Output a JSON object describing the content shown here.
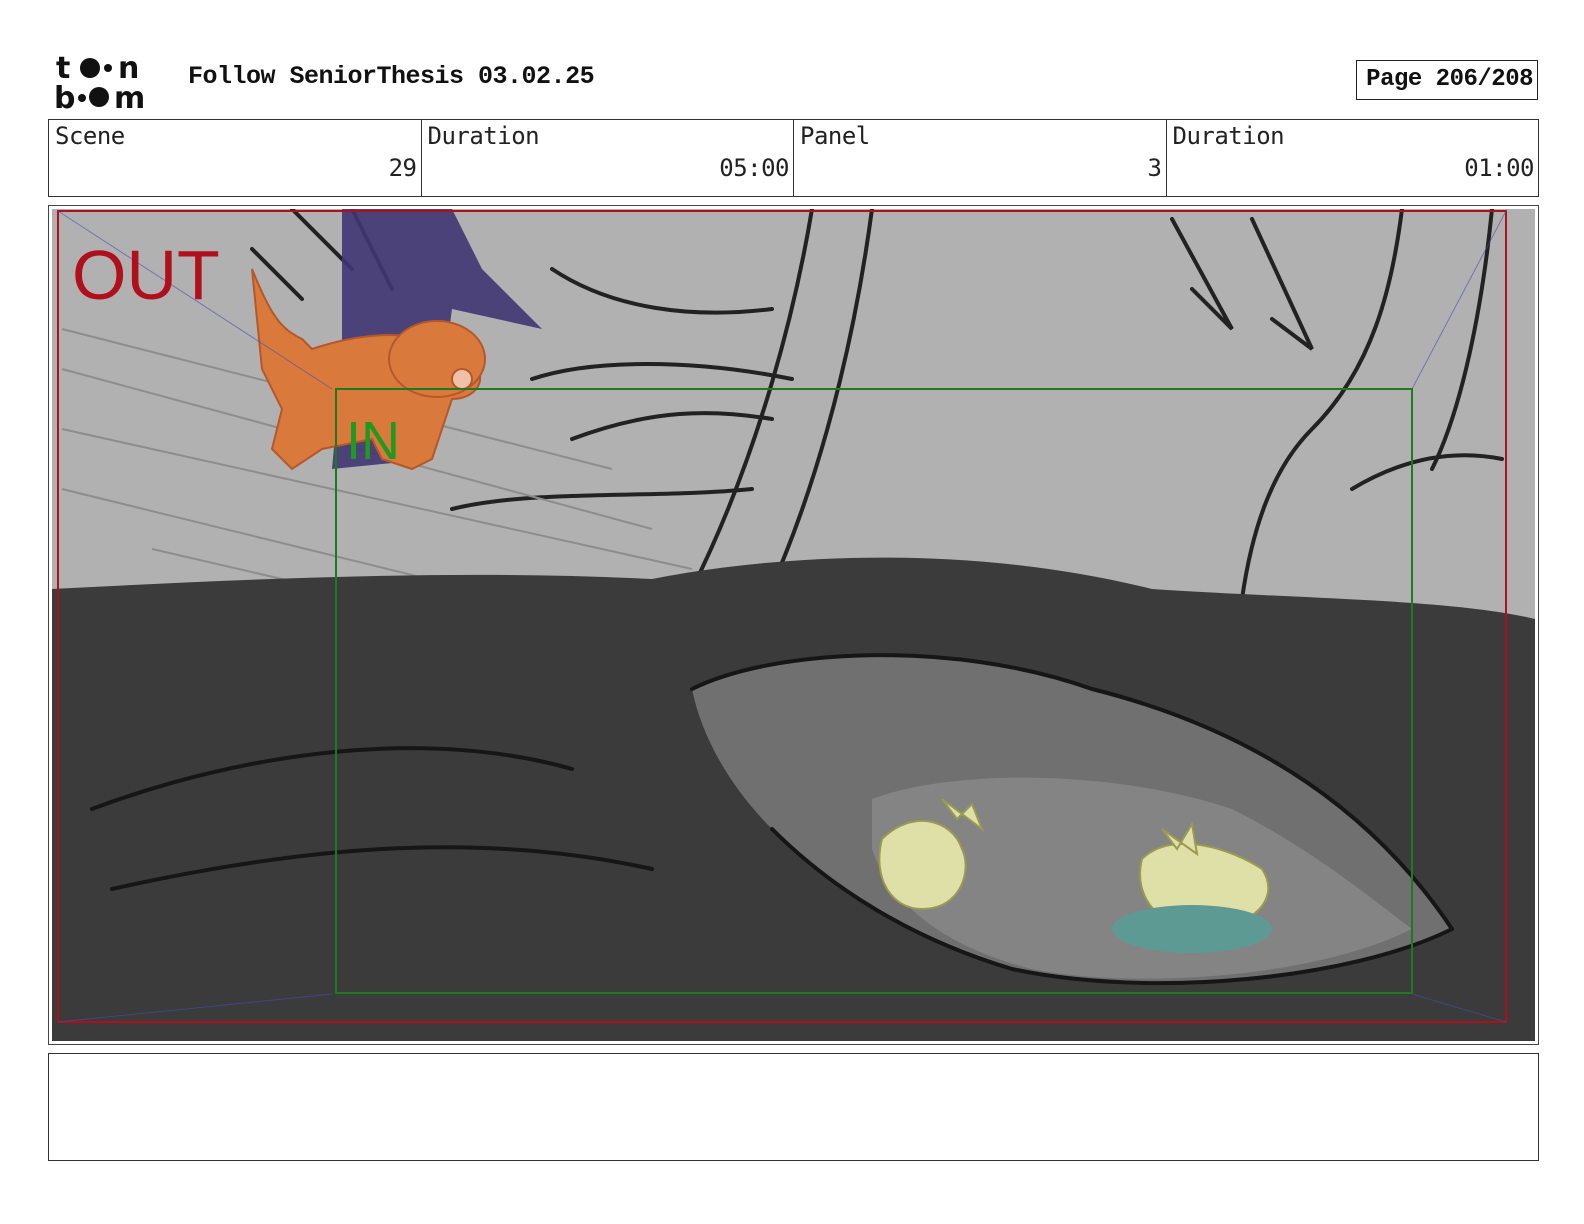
{
  "header": {
    "logo_text": "toon boom",
    "title": "Follow SeniorThesis 03.02.25",
    "page": "Page 206/208"
  },
  "info": {
    "scene_label": "Scene",
    "scene_value": "29",
    "scene_duration_label": "Duration",
    "scene_duration_value": "05:00",
    "panel_label": "Panel",
    "panel_value": "3",
    "panel_duration_label": "Duration",
    "panel_duration_value": "01:00"
  },
  "panel": {
    "out_marker": "OUT",
    "in_marker": "IN",
    "colors": {
      "out_frame": "#b0101c",
      "in_frame": "#1f7a1f",
      "sky": "#b1b1b1",
      "ground": "#3b3b3b",
      "burrow": "#707070",
      "dog": "#d97a3c",
      "shadow_figure": "#3f3672",
      "foxes": "#dfe0a8",
      "bush": "#5e9a94"
    }
  },
  "notes": {
    "text": ""
  }
}
